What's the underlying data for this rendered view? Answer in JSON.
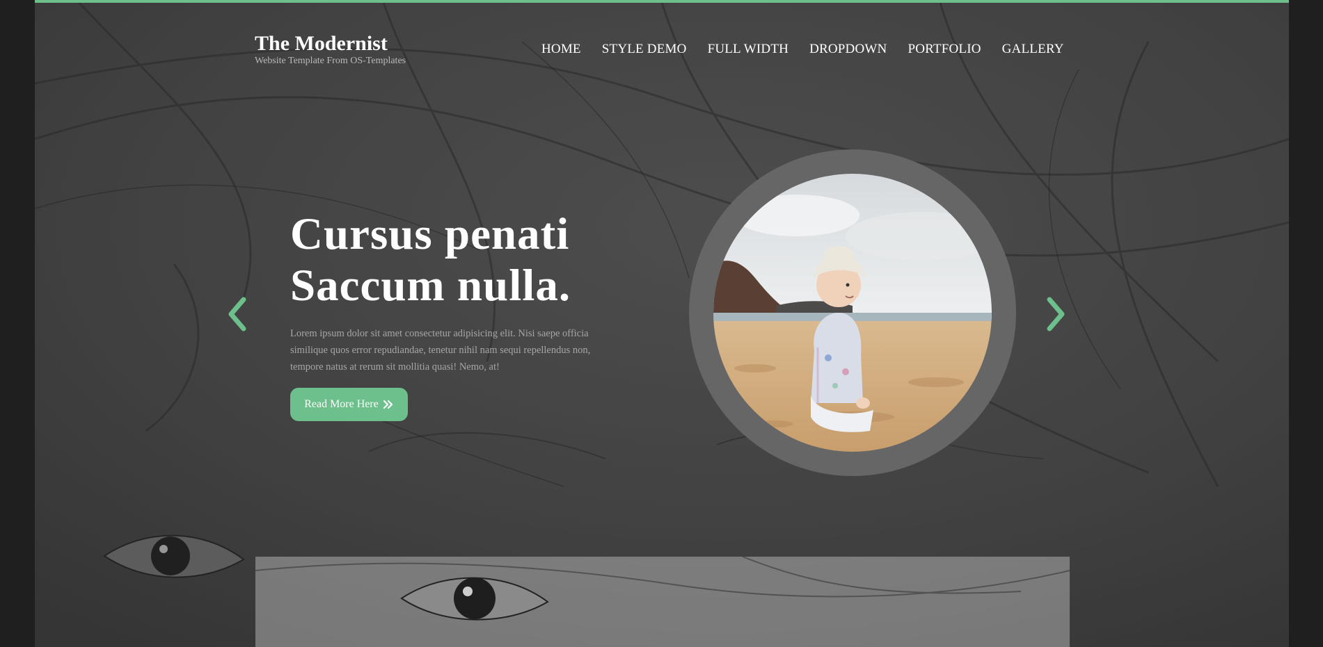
{
  "brand": {
    "title": "The Modernist",
    "tagline": "Website Template From OS-Templates",
    "accent_color": "#6dbf8c"
  },
  "nav": {
    "items": [
      {
        "label": "HOME"
      },
      {
        "label": "STYLE DEMO"
      },
      {
        "label": "FULL WIDTH"
      },
      {
        "label": "DROPDOWN"
      },
      {
        "label": "PORTFOLIO"
      },
      {
        "label": "GALLERY"
      }
    ]
  },
  "hero": {
    "title_line1": "Cursus penati",
    "title_line2": "Saccum nulla.",
    "body": "Lorem ipsum dolor sit amet consectetur adipisicing elit. Nisi saepe officia similique quos error repudiandae, tenetur nihil nam sequi repellendus non, tempore natus at rerum sit mollitia quasi! Nemo, at!",
    "button_label": "Read More Here",
    "button_icon": "double-chevron-right-icon"
  },
  "slider": {
    "prev_icon": "chevron-left-icon",
    "next_icon": "chevron-right-icon"
  },
  "background": {
    "image": "pencil-sketch-face"
  },
  "photo": {
    "subject": "child-on-beach"
  }
}
